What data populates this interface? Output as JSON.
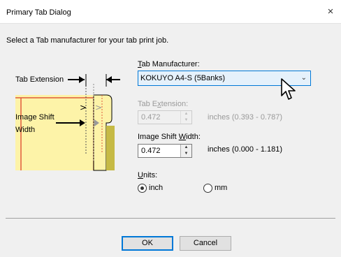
{
  "window": {
    "title": "Primary Tab Dialog",
    "close_glyph": "×"
  },
  "instruction": "Select a Tab manufacturer for your tab print job.",
  "diagram": {
    "tab_extension_label": "Tab Extension",
    "image_shift_label_line1": "Image Shift",
    "image_shift_label_line2": "Width",
    "colors": {
      "page_fill": "#fdf3a8",
      "page_border": "#e05a3a",
      "tab_fill": "#c6ba45",
      "arrow": "#000000"
    }
  },
  "tab_manufacturer": {
    "label_first": "T",
    "label_rest": "ab Manufacturer:",
    "selected": "KOKUYO A4-S (5Banks)"
  },
  "tab_extension": {
    "label_pre": "Tab E",
    "label_u": "x",
    "label_post": "tension:",
    "value": "0.472",
    "range": "inches (0.393 - 0.787)"
  },
  "image_shift": {
    "label_pre": "Image Shift ",
    "label_u": "W",
    "label_post": "idth:",
    "value": "0.472",
    "range": "inches (0.000 - 1.181)"
  },
  "units": {
    "label_first": "U",
    "label_rest": "nits:",
    "option_inch": "inch",
    "option_mm": "mm",
    "selected": "inch"
  },
  "buttons": {
    "ok": "OK",
    "cancel": "Cancel"
  },
  "accent_color": "#0078d7"
}
